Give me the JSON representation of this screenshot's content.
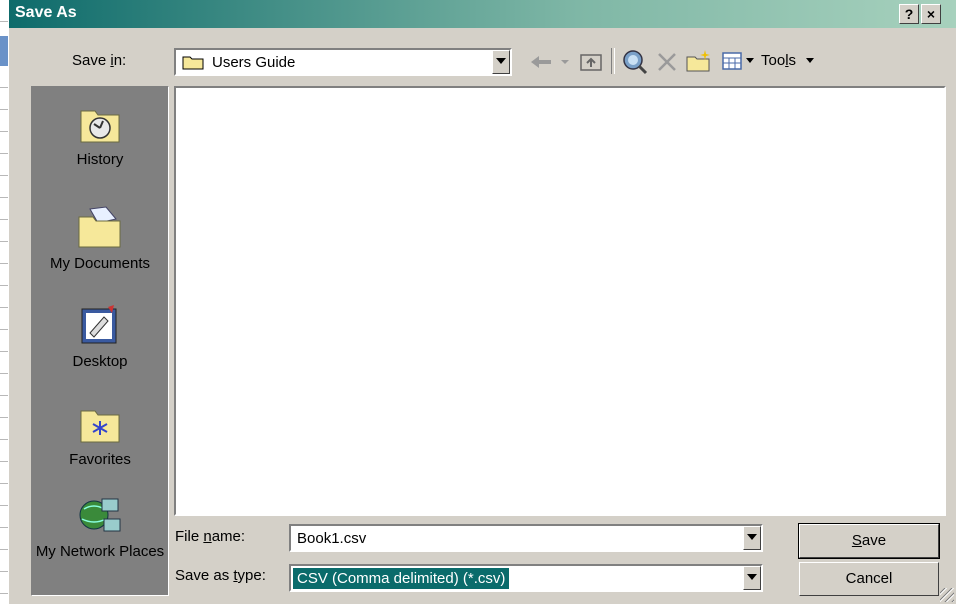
{
  "window": {
    "title": "Save As",
    "help_label": "?",
    "close_label": "×"
  },
  "toolbar": {
    "save_in_label": "Save in:",
    "save_in_value": "Users Guide",
    "tools_label": "Tools",
    "icons": [
      "back-arrow-icon",
      "up-folder-icon",
      "search-web-icon",
      "delete-icon",
      "new-folder-icon",
      "views-icon"
    ]
  },
  "places": [
    {
      "label": "History",
      "icon": "history-icon"
    },
    {
      "label": "My Documents",
      "icon": "my-documents-icon"
    },
    {
      "label": "Desktop",
      "icon": "desktop-icon"
    },
    {
      "label": "Favorites",
      "icon": "favorites-icon"
    },
    {
      "label": "My Network Places",
      "icon": "network-places-icon"
    }
  ],
  "form": {
    "file_name_label": "File name:",
    "file_name_value": "Book1.csv",
    "save_type_label": "Save as type:",
    "save_type_value": "CSV (Comma delimited) (*.csv)"
  },
  "buttons": {
    "save": "Save",
    "cancel": "Cancel"
  },
  "colors": {
    "title_start": "#0e6b6b",
    "title_end": "#a7d1bd",
    "selection": "#0a6b6b",
    "face": "#d4d0c8"
  }
}
